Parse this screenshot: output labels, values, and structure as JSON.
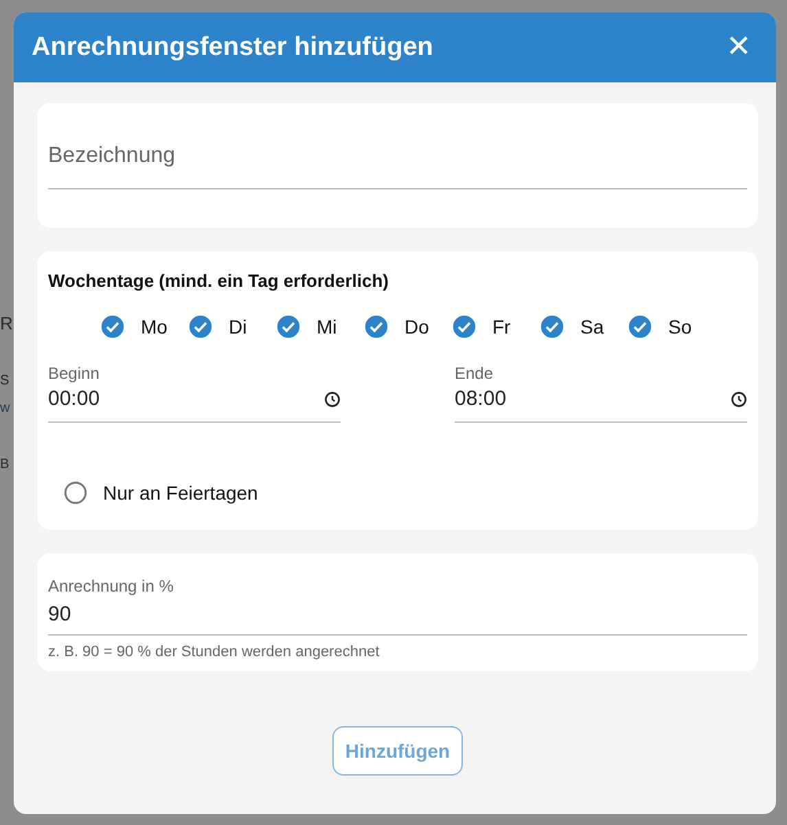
{
  "background": {
    "texts": [
      {
        "kind": "heading",
        "text": "R"
      },
      {
        "kind": "small",
        "text": "S"
      },
      {
        "kind": "link",
        "text": "w"
      },
      {
        "kind": "label",
        "text": "B"
      }
    ]
  },
  "dialog": {
    "title": "Anrechnungsfenster hinzufügen",
    "close": "✕",
    "name_field": {
      "placeholder": "Bezeichnung"
    },
    "weekdays": {
      "title": "Wochentage (mind. ein Tag erforderlich)",
      "days": [
        {
          "label": "Mo",
          "checked": true
        },
        {
          "label": "Di",
          "checked": true
        },
        {
          "label": "Mi",
          "checked": true
        },
        {
          "label": "Do",
          "checked": true
        },
        {
          "label": "Fr",
          "checked": true
        },
        {
          "label": "Sa",
          "checked": true
        },
        {
          "label": "So",
          "checked": true
        }
      ]
    },
    "times": [
      {
        "label": "Beginn",
        "value": "00:00"
      },
      {
        "label": "Ende",
        "value": "08:00"
      }
    ],
    "holidays": {
      "label": "Nur an Feiertagen",
      "checked": false
    },
    "percent": {
      "label": "Anrechnung in %",
      "value": "90",
      "hint": "z. B. 90 = 90 % der Stunden werden angerechnet"
    },
    "button": "Hinzufügen"
  }
}
